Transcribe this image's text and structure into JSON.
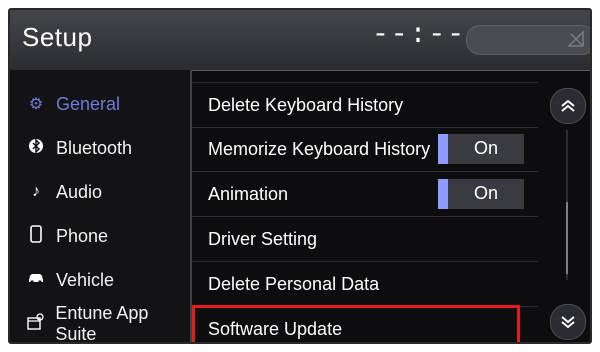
{
  "header": {
    "title": "Setup",
    "clock": "--:--"
  },
  "sidebar": {
    "items": [
      {
        "label": "General",
        "icon": "gear-icon",
        "active": true
      },
      {
        "label": "Bluetooth",
        "icon": "bluetooth-icon",
        "active": false
      },
      {
        "label": "Audio",
        "icon": "music-note-icon",
        "active": false
      },
      {
        "label": "Phone",
        "icon": "phone-icon",
        "active": false
      },
      {
        "label": "Vehicle",
        "icon": "car-icon",
        "active": false
      },
      {
        "label": "Entune App Suite",
        "icon": "apps-icon",
        "active": false
      }
    ]
  },
  "settings": {
    "rows": [
      {
        "label": "Delete Keyboard History"
      },
      {
        "label": "Memorize Keyboard History",
        "toggle": "On"
      },
      {
        "label": "Animation",
        "toggle": "On"
      },
      {
        "label": "Driver Setting"
      },
      {
        "label": "Delete Personal Data"
      },
      {
        "label": "Software Update",
        "highlighted": true
      }
    ]
  },
  "colors": {
    "active_accent": "#6d7bd8",
    "toggle_bar": "#8e9bff",
    "highlight_box": "#e21c1c"
  }
}
